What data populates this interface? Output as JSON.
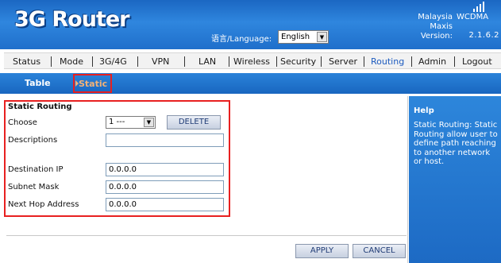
{
  "header": {
    "logo": "3G Router",
    "language_label": "语言/Language:",
    "language_value": "English",
    "country": "Malaysia",
    "operator": "Maxis",
    "version_label": "Version:",
    "network": "WCDMA",
    "version": "2.1.6.2"
  },
  "nav": {
    "items": [
      "Status",
      "Mode",
      "3G/4G",
      "VPN",
      "LAN",
      "Wireless",
      "Security",
      "Server",
      "Routing",
      "Admin",
      "Logout"
    ],
    "active": "Routing"
  },
  "subtabs": {
    "table": "Table",
    "static": "Static"
  },
  "form": {
    "title": "Static Routing",
    "choose_label": "Choose",
    "choose_value": "1 ---",
    "delete_label": "DELETE",
    "descriptions_label": "Descriptions",
    "descriptions_value": "",
    "dest_ip_label": "Destination IP",
    "dest_ip_value": "0.0.0.0",
    "subnet_label": "Subnet Mask",
    "subnet_value": "0.0.0.0",
    "nexthop_label": "Next Hop Address",
    "nexthop_value": "0.0.0.0",
    "apply_label": "APPLY",
    "cancel_label": "CANCEL"
  },
  "help": {
    "title": "Help",
    "text": "Static Routing: Static Routing allow user to define path reaching to another network or host."
  },
  "colors": {
    "header_blue": "#2f86de",
    "highlight_red": "#e82020",
    "tab_orange": "#f3b277"
  },
  "icons": {
    "signal": "signal-icon",
    "dropdown": "chevron-down-icon"
  }
}
